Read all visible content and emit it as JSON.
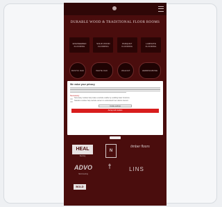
{
  "site": {
    "title": "DURABLE WOOD & TRADITIONAL FLOOR ROOMS"
  },
  "nav": [
    {
      "label": "ENGINEERED FLOORING"
    },
    {
      "label": "SOLID WOOD FLOORING"
    },
    {
      "label": "PARQUET FLOORING"
    },
    {
      "label": "LAMINATE FLOORING"
    }
  ],
  "badges": [
    {
      "label": "RUSTIC OAK"
    },
    {
      "label": "WHITE OAK"
    },
    {
      "label": "WALNUT"
    },
    {
      "label": "HERRINGBONE"
    }
  ],
  "consent": {
    "title": "We value your privacy",
    "section_label": "Necessary",
    "option1": "Necessary cookies help make a website usable by enabling basic functions.",
    "option2": "Statistics cookies help website owners to understand how visitors interact.",
    "settings_label": "Cookie settings",
    "accept_label": "Accept all cookies"
  },
  "brands": {
    "b1": "HEAL",
    "b1_sub": "flooring",
    "b2": "N",
    "b3": "timber floors",
    "b4": "ADVO",
    "b4_sub": "floorcovering",
    "b5": "†",
    "b6": "LINS",
    "b7": "BOLD"
  },
  "colors": {
    "background": "#4a0d0d",
    "accent": "#d81d1d"
  }
}
